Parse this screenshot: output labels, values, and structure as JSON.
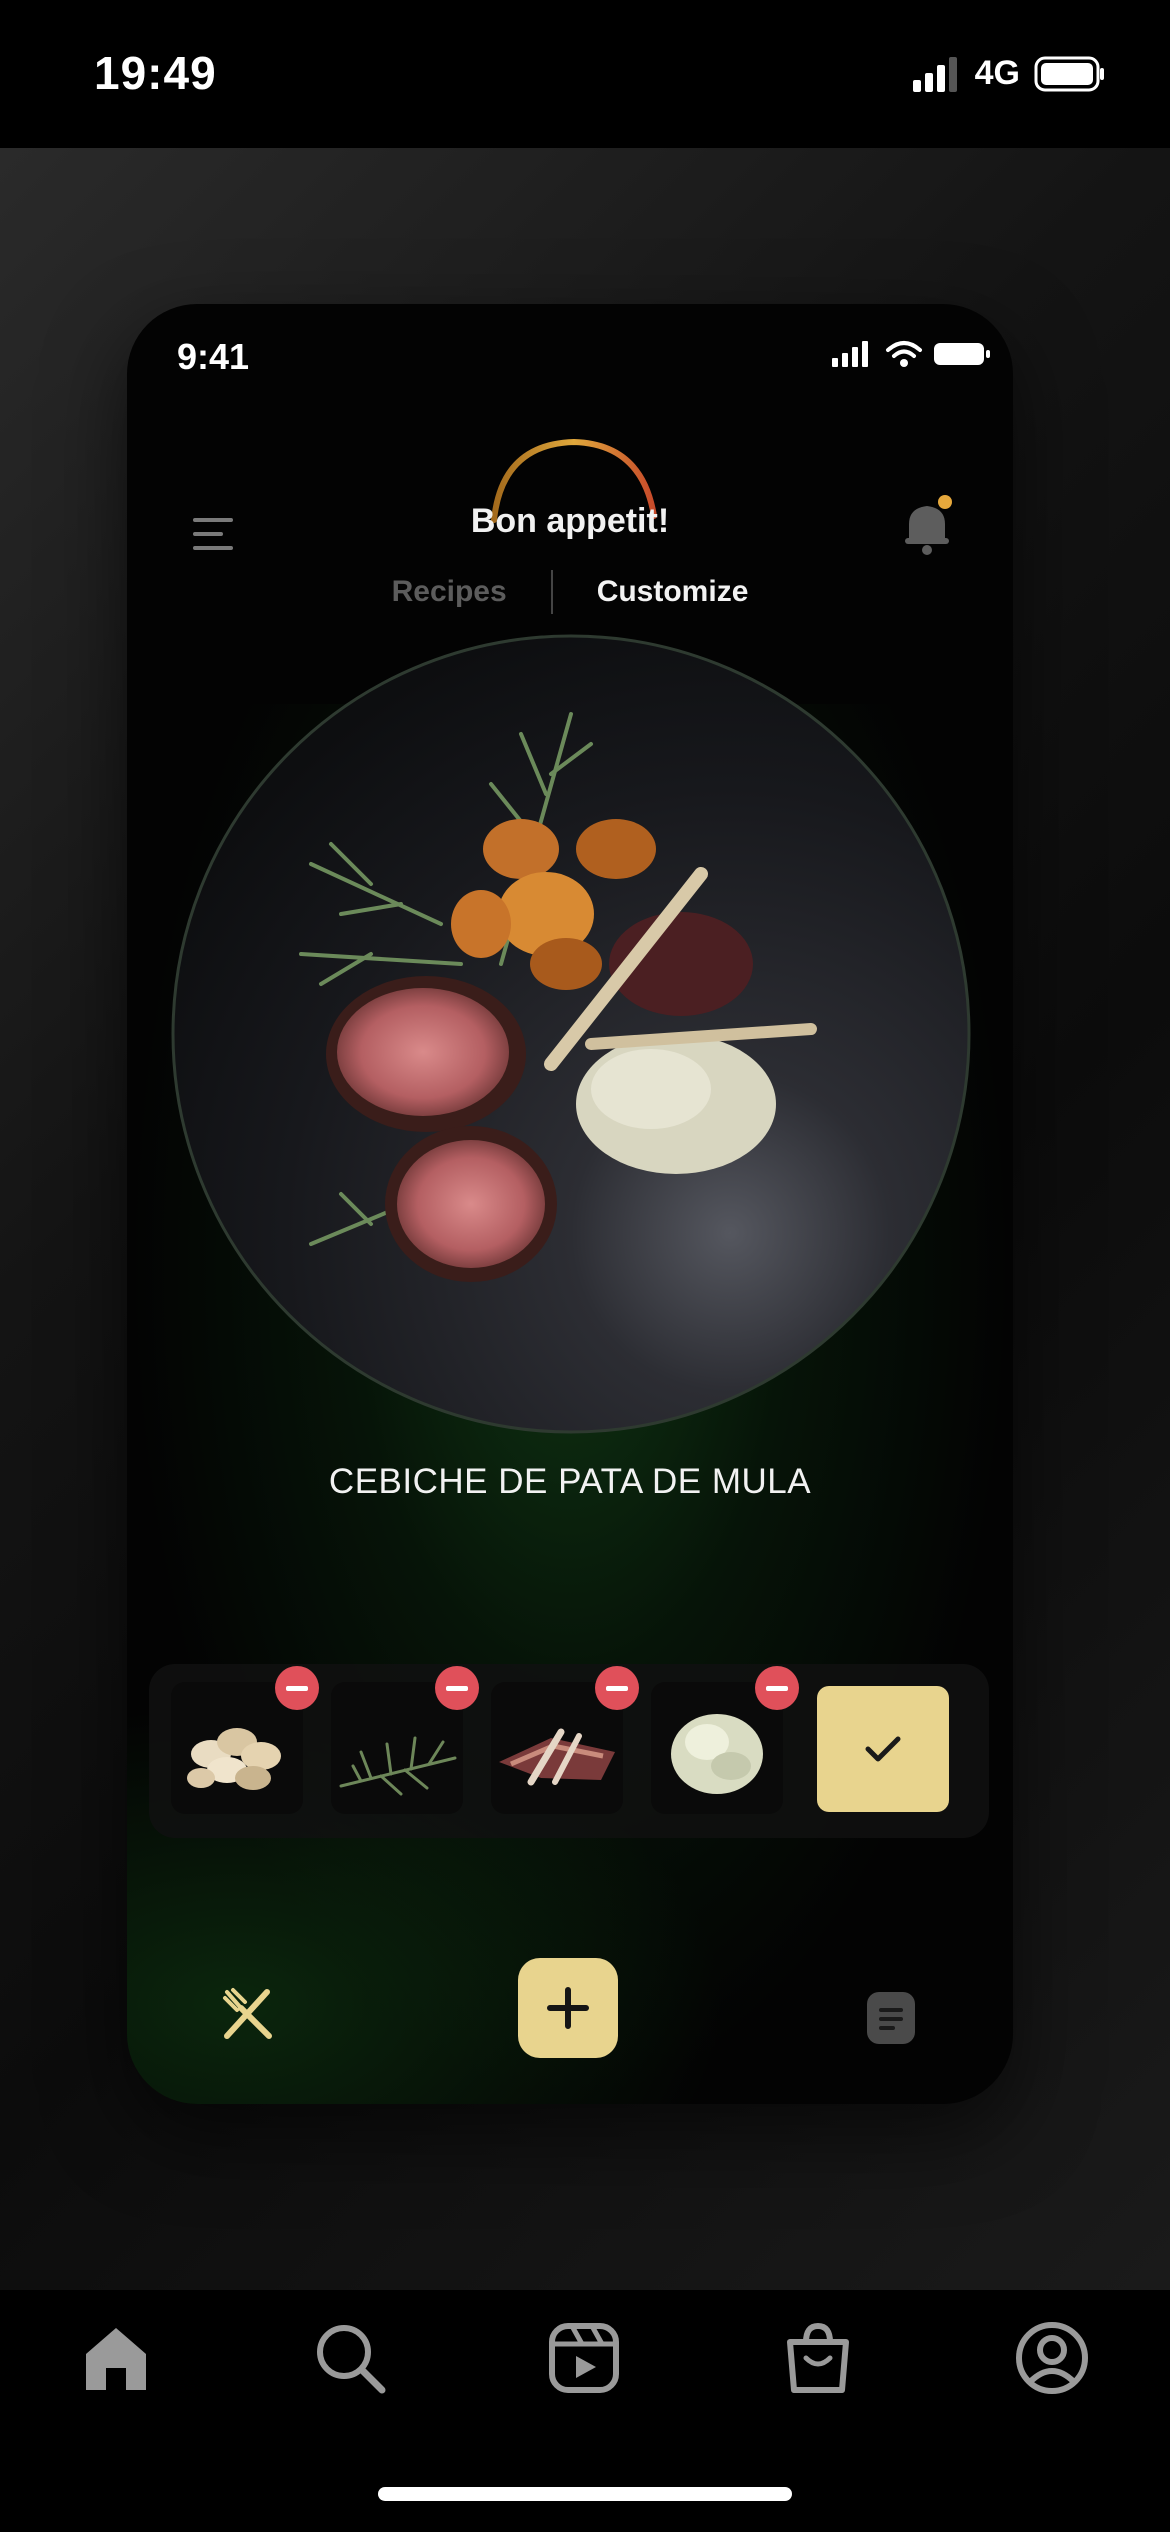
{
  "os_status": {
    "time": "19:49",
    "network": "4G"
  },
  "mockup": {
    "status_time": "9:41",
    "brand_title": "Bon appetit!",
    "tabs": [
      {
        "label": "Recipes",
        "active": false
      },
      {
        "label": "Customize",
        "active": true
      }
    ],
    "dish_name": "CEBICHE DE PATA DE MULA",
    "ingredients": [
      {
        "icon": "beans-ingredient"
      },
      {
        "icon": "rosemary-ingredient"
      },
      {
        "icon": "meat-ingredient"
      },
      {
        "icon": "mashed-ingredient"
      }
    ],
    "colors": {
      "accent": "#e8d48e",
      "remove": "#e0505a",
      "glow": "#14461a"
    }
  },
  "tabbar": {
    "items": [
      "home-icon",
      "search-icon",
      "reels-icon",
      "shop-icon",
      "profile-icon"
    ]
  }
}
